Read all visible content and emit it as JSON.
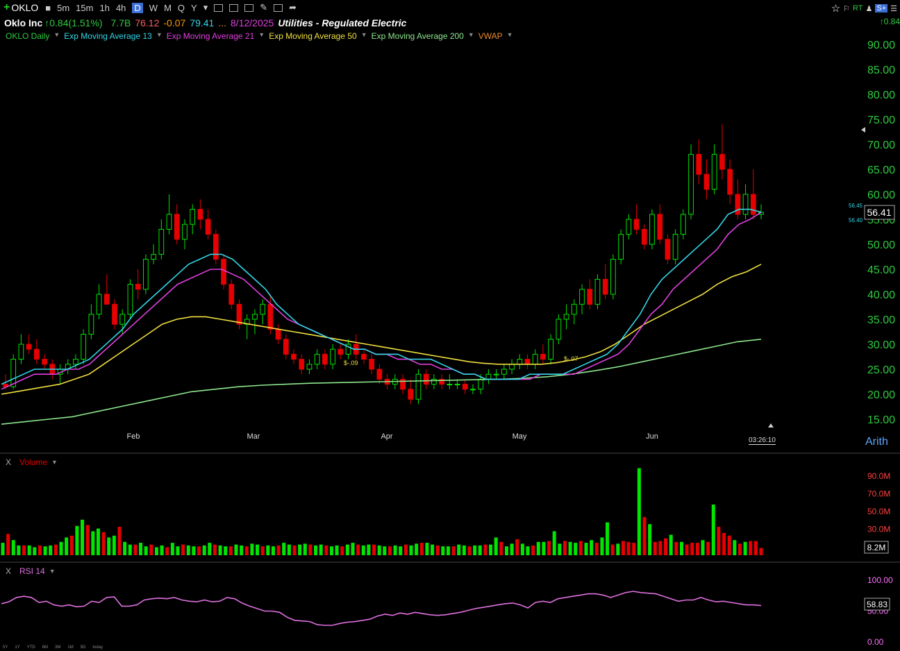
{
  "toolbar": {
    "symbol": "OKLO",
    "intervals": [
      "5m",
      "15m",
      "1h",
      "4h",
      "D",
      "W",
      "M",
      "Q",
      "Y"
    ],
    "active": "D",
    "rt": "RT",
    "splus": "S+"
  },
  "info": {
    "name": "Oklo Inc",
    "change": "↑0.84(1.51%)",
    "volume": "7.7B",
    "high": "76.12",
    "chg2": "-0.07",
    "low": "79.41",
    "dots": "...",
    "date": "8/12/2025",
    "sector": "Utilities - Regulated Electric",
    "right_change": "↑0.84"
  },
  "legend": [
    {
      "label": "OKLO Daily",
      "color": "#2ecc40"
    },
    {
      "label": "Exp Moving Average 13",
      "color": "#33d6e8"
    },
    {
      "label": "Exp Moving Average 21",
      "color": "#e040e0"
    },
    {
      "label": "Exp Moving Average 50",
      "color": "#f0e040"
    },
    {
      "label": "Exp Moving Average 200",
      "color": "#8ee88e"
    },
    {
      "label": "VWAP",
      "color": "#f08a2a"
    }
  ],
  "colors": {
    "up": "#00e600",
    "down": "#e60000",
    "price_axis": "#2ecc40",
    "ema13": "#33d6e8",
    "ema21": "#e040e0",
    "ema50": "#f0e040",
    "ema200": "#8ee88e",
    "rsi": "#e070e0"
  },
  "price_axis": [
    "90.00",
    "85.00",
    "80.00",
    "75.00",
    "70.00",
    "65.00",
    "60.00",
    "55.00",
    "50.00",
    "45.00",
    "40.00",
    "35.00",
    "30.00",
    "25.00",
    "20.00",
    "15.00"
  ],
  "price_labels": {
    "last": "56.41",
    "ema13": "56.45",
    "ema21": "56.40"
  },
  "months": [
    "Feb",
    "Mar",
    "Apr",
    "May",
    "Jun"
  ],
  "time": "03:26:10",
  "scale": "Arith",
  "volume_pane": {
    "label": "Volume",
    "axis": [
      "90.0M",
      "70.0M",
      "50.0M",
      "30.0M"
    ],
    "last": "8.2M",
    "close_icon": "X"
  },
  "rsi_pane": {
    "label": "RSI 14",
    "axis": [
      "100.00",
      "50.00",
      "0.00"
    ],
    "last": "58.83",
    "close_icon": "X"
  },
  "markers": [
    "$-.09",
    "$-.07"
  ],
  "range_buttons": [
    "5Y",
    "1Y",
    "YTD",
    "6M",
    "3M",
    "1M",
    "5D",
    "today"
  ],
  "chart_data": {
    "type": "candlestick",
    "ylim": [
      15,
      90
    ],
    "candles": [
      [
        22,
        24,
        21,
        21.5
      ],
      [
        21.5,
        28,
        21,
        27
      ],
      [
        27,
        32,
        26,
        30
      ],
      [
        30,
        32,
        28,
        29
      ],
      [
        29,
        31,
        26,
        27
      ],
      [
        27,
        28,
        25,
        26
      ],
      [
        26,
        27,
        23,
        24
      ],
      [
        24,
        26,
        22,
        25
      ],
      [
        25,
        27,
        24,
        26
      ],
      [
        26,
        28,
        25,
        27
      ],
      [
        27,
        33,
        26,
        32
      ],
      [
        32,
        38,
        31,
        36
      ],
      [
        36,
        42,
        35,
        40
      ],
      [
        40,
        44,
        38,
        38
      ],
      [
        38,
        39,
        33,
        34
      ],
      [
        34,
        37,
        32,
        36
      ],
      [
        36,
        43,
        35,
        42
      ],
      [
        42,
        45,
        39,
        41
      ],
      [
        41,
        48,
        40,
        47
      ],
      [
        47,
        50,
        46,
        48
      ],
      [
        48,
        55,
        47,
        53
      ],
      [
        53,
        60,
        52,
        56
      ],
      [
        56,
        58,
        50,
        51
      ],
      [
        51,
        55,
        49,
        54
      ],
      [
        54,
        58,
        52,
        57
      ],
      [
        57,
        59,
        53,
        55
      ],
      [
        55,
        57,
        51,
        52
      ],
      [
        52,
        53,
        46,
        47
      ],
      [
        47,
        48,
        41,
        42
      ],
      [
        42,
        43,
        37,
        38
      ],
      [
        38,
        39,
        33,
        34
      ],
      [
        34,
        36,
        31,
        35
      ],
      [
        35,
        37,
        32,
        36
      ],
      [
        36,
        39,
        34,
        38
      ],
      [
        38,
        40,
        32,
        33
      ],
      [
        33,
        34,
        30,
        31
      ],
      [
        31,
        32,
        27,
        28
      ],
      [
        28,
        29,
        26,
        27
      ],
      [
        27,
        28,
        24,
        25
      ],
      [
        25,
        27,
        24,
        26
      ],
      [
        26,
        29,
        25,
        28
      ],
      [
        28,
        29,
        25,
        26
      ],
      [
        26,
        30,
        25,
        29
      ],
      [
        29,
        30,
        27,
        28
      ],
      [
        28,
        31,
        27,
        30
      ],
      [
        30,
        32,
        27,
        28
      ],
      [
        28,
        29,
        26,
        27
      ],
      [
        27,
        28,
        24,
        25
      ],
      [
        25,
        26,
        22,
        23
      ],
      [
        23,
        24,
        21,
        22
      ],
      [
        22,
        24,
        21,
        23
      ],
      [
        23,
        24,
        20,
        21
      ],
      [
        21,
        23,
        18,
        19
      ],
      [
        19,
        25,
        18,
        24
      ],
      [
        24,
        25,
        21,
        22
      ],
      [
        22,
        24,
        21,
        23
      ],
      [
        23,
        24,
        21,
        22
      ],
      [
        22,
        24,
        21,
        22
      ],
      [
        22,
        23,
        21,
        22
      ],
      [
        22,
        23,
        20,
        21
      ],
      [
        21,
        22,
        20,
        21
      ],
      [
        21,
        24,
        20,
        23
      ],
      [
        23,
        25,
        22,
        24
      ],
      [
        24,
        25,
        23,
        24
      ],
      [
        24,
        26,
        23,
        25
      ],
      [
        25,
        27,
        24,
        26
      ],
      [
        26,
        28,
        25,
        27
      ],
      [
        27,
        28,
        25,
        26
      ],
      [
        26,
        29,
        25,
        28
      ],
      [
        28,
        30,
        26,
        27
      ],
      [
        27,
        32,
        26,
        31
      ],
      [
        31,
        36,
        30,
        35
      ],
      [
        35,
        38,
        33,
        36
      ],
      [
        36,
        39,
        34,
        38
      ],
      [
        38,
        42,
        36,
        41
      ],
      [
        41,
        43,
        37,
        38
      ],
      [
        38,
        44,
        37,
        43
      ],
      [
        43,
        46,
        39,
        40
      ],
      [
        40,
        48,
        39,
        47
      ],
      [
        47,
        53,
        46,
        52
      ],
      [
        52,
        56,
        51,
        55
      ],
      [
        55,
        58,
        52,
        53
      ],
      [
        53,
        54,
        49,
        50
      ],
      [
        50,
        57,
        49,
        56
      ],
      [
        56,
        58,
        50,
        51
      ],
      [
        51,
        52,
        46,
        47
      ],
      [
        47,
        53,
        46,
        52
      ],
      [
        52,
        57,
        51,
        56
      ],
      [
        56,
        70,
        55,
        68
      ],
      [
        68,
        71,
        62,
        64
      ],
      [
        64,
        67,
        59,
        61
      ],
      [
        61,
        70,
        60,
        68
      ],
      [
        68,
        74,
        63,
        65
      ],
      [
        65,
        67,
        58,
        60
      ],
      [
        60,
        63,
        55,
        56
      ],
      [
        56,
        62,
        55,
        60
      ],
      [
        60,
        65,
        55,
        56
      ],
      [
        56,
        58,
        55,
        56.4
      ]
    ],
    "ema13": [
      22,
      23,
      24,
      25,
      25,
      25,
      25,
      26,
      27,
      29,
      31,
      33,
      36,
      38,
      40,
      42,
      44,
      46,
      47,
      48,
      48,
      47,
      45,
      43,
      41,
      38,
      36,
      34,
      33,
      32,
      31,
      30,
      29,
      29,
      28,
      28,
      28,
      27,
      27,
      27,
      26,
      25,
      24,
      24,
      23,
      23,
      23,
      23,
      24,
      24,
      24,
      24,
      25,
      26,
      27,
      28,
      30,
      33,
      36,
      40,
      43,
      45,
      47,
      49,
      51,
      53,
      56,
      57,
      57,
      56.45
    ],
    "ema21": [
      21,
      22,
      23,
      24,
      24,
      24,
      25,
      25,
      26,
      28,
      30,
      32,
      34,
      36,
      38,
      40,
      42,
      43,
      44,
      45,
      45,
      44,
      43,
      41,
      39,
      37,
      35,
      34,
      33,
      32,
      31,
      30,
      29,
      29,
      28,
      28,
      27,
      27,
      26,
      26,
      25,
      25,
      24,
      24,
      23,
      23,
      23,
      23,
      23,
      24,
      24,
      24,
      24,
      25,
      26,
      27,
      28,
      30,
      33,
      36,
      38,
      41,
      43,
      45,
      47,
      49,
      52,
      54,
      55,
      56.4
    ],
    "ema50": [
      20,
      20.5,
      21,
      21.5,
      22,
      23,
      24,
      26,
      28,
      30,
      32,
      34,
      35,
      35.5,
      35.5,
      35,
      34.5,
      34,
      33.5,
      33,
      32.5,
      32,
      31.5,
      31,
      30.5,
      30,
      29.5,
      29,
      28.5,
      28,
      27.5,
      27,
      26.5,
      26.2,
      26,
      26,
      26,
      26,
      26.3,
      26.8,
      27.5,
      28.5,
      30,
      32,
      34,
      35.5,
      37,
      38.5,
      40,
      42,
      43.5,
      44.5,
      46
    ],
    "ema200": [
      14,
      14.5,
      15,
      15.5,
      16.5,
      17.5,
      18.5,
      19.5,
      20.5,
      21,
      21.5,
      21.8,
      22,
      22.2,
      22.3,
      22.4,
      22.5,
      22.6,
      22.7,
      22.8,
      22.9,
      23,
      23.2,
      23.5,
      24,
      24.7,
      25.5,
      26.5,
      27.5,
      28.5,
      29.5,
      30.5,
      31
    ],
    "volume": [
      14,
      24,
      17,
      11,
      11,
      11,
      9,
      11,
      10,
      11,
      12,
      15,
      20,
      22,
      33,
      40,
      34,
      27,
      30,
      26,
      20,
      22,
      32,
      15,
      12,
      12,
      14,
      10,
      12,
      9,
      11,
      9,
      14,
      10,
      12,
      11,
      10,
      10,
      11,
      14,
      12,
      11,
      10,
      10,
      12,
      11,
      10,
      13,
      12,
      10,
      11,
      10,
      11,
      14,
      12,
      11,
      12,
      13,
      12,
      11,
      12,
      11,
      10,
      11,
      10,
      12,
      14,
      12,
      11,
      12,
      12,
      11,
      10,
      10,
      11,
      10,
      12,
      11,
      13,
      14,
      14,
      12,
      11,
      10,
      10,
      10,
      12,
      11,
      10,
      11,
      11,
      12,
      12,
      20,
      15,
      10,
      13,
      18,
      13,
      10,
      11,
      15,
      15,
      16,
      27,
      13,
      16,
      15,
      14,
      16,
      14,
      17,
      14,
      20,
      37,
      12,
      13,
      16,
      15,
      14,
      98,
      43,
      35,
      15,
      16,
      19,
      23,
      15,
      15,
      12,
      14,
      14,
      17,
      15,
      57,
      32,
      25,
      22,
      17,
      13,
      15,
      16,
      16,
      8.2
    ],
    "rsi": [
      62,
      65,
      72,
      74,
      72,
      64,
      66,
      60,
      58,
      60,
      57,
      58,
      66,
      64,
      72,
      73,
      58,
      58,
      60,
      68,
      70,
      71,
      70,
      72,
      68,
      66,
      65,
      68,
      65,
      66,
      72,
      70,
      63,
      58,
      54,
      50,
      50,
      48,
      40,
      35,
      34,
      33,
      28,
      27,
      27,
      30,
      32,
      33,
      35,
      37,
      42,
      45,
      43,
      47,
      45,
      48,
      46,
      44,
      43,
      44,
      46,
      48,
      51,
      54,
      56,
      58,
      60,
      62,
      63,
      60,
      55,
      64,
      66,
      64,
      70,
      72,
      74,
      76,
      78,
      78,
      76,
      72,
      76,
      80,
      82,
      80,
      79,
      78,
      74,
      70,
      66,
      68,
      68,
      72,
      68,
      65,
      66,
      64,
      62,
      60,
      60,
      58.83
    ]
  }
}
